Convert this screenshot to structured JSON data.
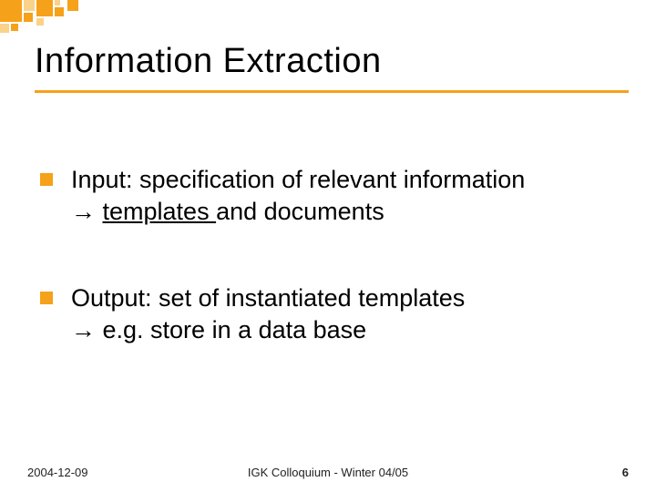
{
  "title": "Information Extraction",
  "bullets": [
    {
      "line1": "Input: specification of relevant information",
      "arrow": "→",
      "underlined": "templates ",
      "rest": "and documents"
    },
    {
      "line1": "Output: set of instantiated templates",
      "arrow": "→",
      "rest": " e.g. store in a data base"
    }
  ],
  "footer": {
    "date": "2004-12-09",
    "center": "IGK Colloquium - Winter 04/05",
    "page": "6"
  },
  "colors": {
    "accent": "#f6a11a"
  }
}
